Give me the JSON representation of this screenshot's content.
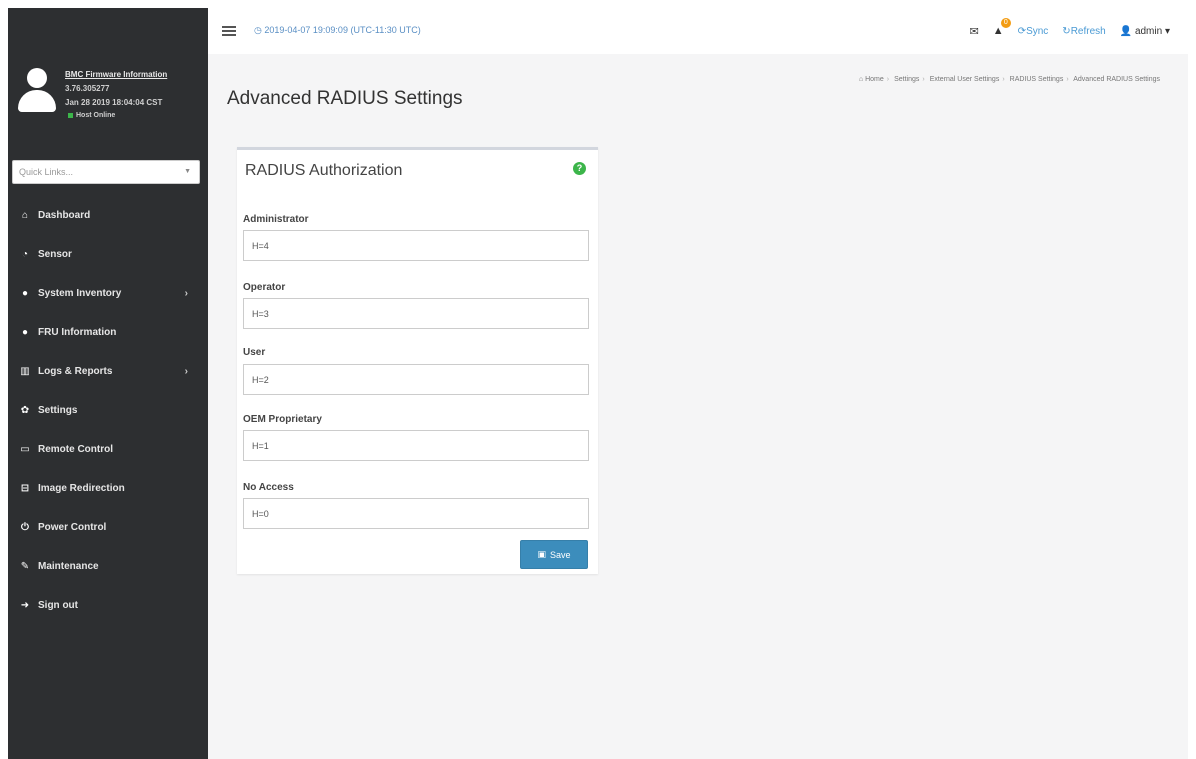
{
  "sidebar": {
    "firmware": {
      "title": "BMC Firmware Information",
      "version": "3.76.305277",
      "build_date": "Jan 28 2019 18:04:04 CST",
      "host_status": "Host Online"
    },
    "quicklinks_placeholder": "Quick Links...",
    "items": [
      {
        "label": "Dashboard",
        "icon": "home-icon",
        "glyph": "⌂",
        "has_submenu": false
      },
      {
        "label": "Sensor",
        "icon": "gauge-icon",
        "glyph": "◔",
        "has_submenu": false
      },
      {
        "label": "System Inventory",
        "icon": "info-icon",
        "glyph": "●",
        "has_submenu": true
      },
      {
        "label": "FRU Information",
        "icon": "info-icon",
        "glyph": "●",
        "has_submenu": false
      },
      {
        "label": "Logs & Reports",
        "icon": "bar-chart-icon",
        "glyph": "▥",
        "has_submenu": true
      },
      {
        "label": "Settings",
        "icon": "gear-icon",
        "glyph": "✿",
        "has_submenu": false
      },
      {
        "label": "Remote Control",
        "icon": "monitor-icon",
        "glyph": "▭",
        "has_submenu": false
      },
      {
        "label": "Image Redirection",
        "icon": "disk-icon",
        "glyph": "⊟",
        "has_submenu": false
      },
      {
        "label": "Power Control",
        "icon": "power-icon",
        "glyph": "⏻",
        "has_submenu": false
      },
      {
        "label": "Maintenance",
        "icon": "wrench-icon",
        "glyph": "✎",
        "has_submenu": false
      },
      {
        "label": "Sign out",
        "icon": "sign-out-icon",
        "glyph": "➜",
        "has_submenu": false
      }
    ]
  },
  "topbar": {
    "datetime": "2019-04-07 19:09:09 (UTC-11:30 UTC)",
    "notification_count": "0",
    "sync_label": "Sync",
    "refresh_label": "Refresh",
    "user_label": "admin"
  },
  "page": {
    "title": "Advanced RADIUS Settings",
    "breadcrumb": [
      "Home",
      "Settings",
      "External User Settings",
      "RADIUS Settings",
      "Advanced RADIUS Settings"
    ]
  },
  "form": {
    "title": "RADIUS Authorization",
    "fields": [
      {
        "label": "Administrator",
        "value": "H=4"
      },
      {
        "label": "Operator",
        "value": "H=3"
      },
      {
        "label": "User",
        "value": "H=2"
      },
      {
        "label": "OEM Proprietary",
        "value": "H=1"
      },
      {
        "label": "No Access",
        "value": "H=0"
      }
    ],
    "save_label": "Save"
  },
  "colors": {
    "sidebar_bg": "#2d2f31",
    "accent": "#3c8dbc",
    "help": "#3cb54a",
    "badge": "#f39c12"
  }
}
